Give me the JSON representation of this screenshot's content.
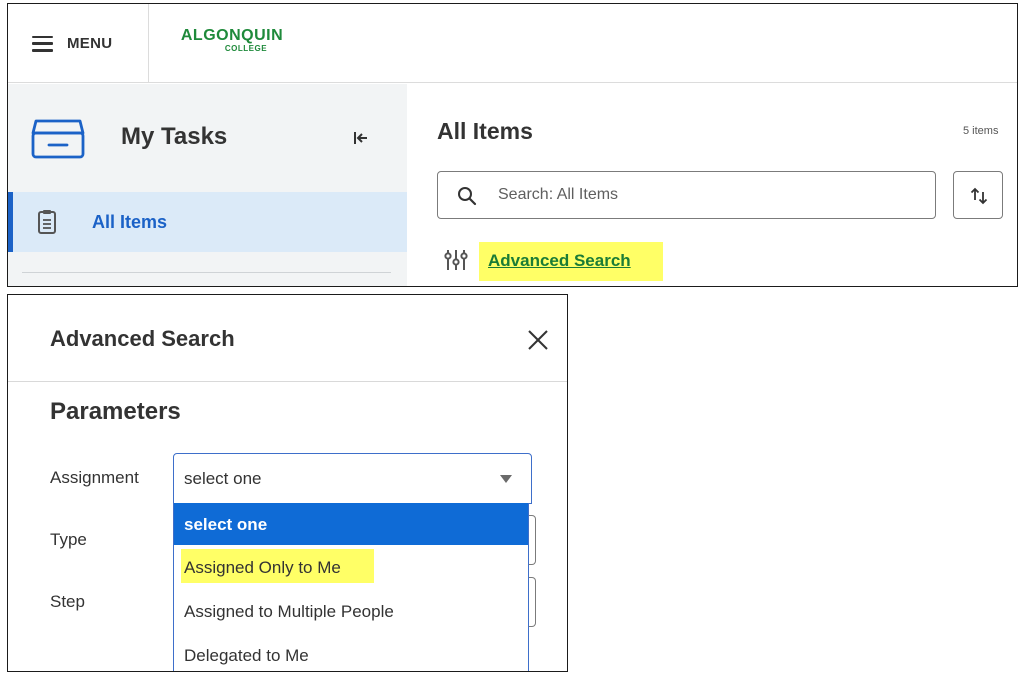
{
  "header": {
    "menu_label": "MENU",
    "logo_text": "ALGONQUIN",
    "logo_subtext": "COLLEGE"
  },
  "sidebar": {
    "title": "My Tasks",
    "items": [
      {
        "label": "All Items",
        "selected": true
      }
    ]
  },
  "main": {
    "title": "All Items",
    "item_count": "5 items",
    "search": {
      "placeholder": "Search: All Items",
      "value": ""
    },
    "advanced_search_link": "Advanced Search"
  },
  "dialog": {
    "title": "Advanced Search",
    "section_title": "Parameters",
    "fields": {
      "assignment": {
        "label": "Assignment",
        "selected_value": "select one",
        "options": [
          "select one",
          "Assigned Only to Me",
          "Assigned to Multiple People",
          "Delegated to Me"
        ]
      },
      "type": {
        "label": "Type"
      },
      "step": {
        "label": "Step"
      }
    }
  },
  "colors": {
    "accent_blue": "#1b62c7",
    "selected_option_bg": "#0f6bd6",
    "highlight_yellow": "#ffff66",
    "link_green": "#1a7c36",
    "sidebar_selected_bg": "#dbeaf8"
  }
}
